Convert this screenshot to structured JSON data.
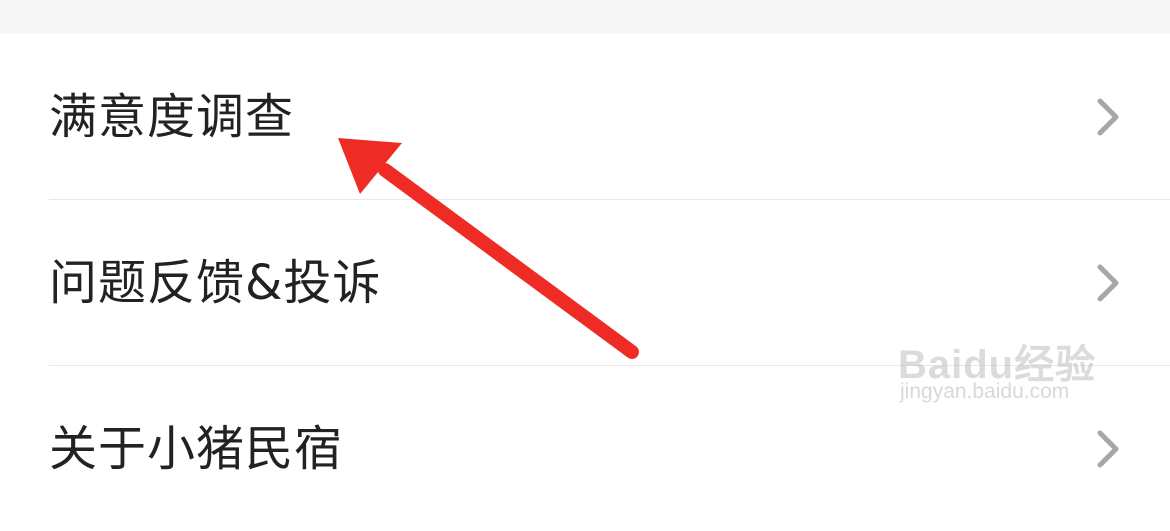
{
  "menu": {
    "items": [
      {
        "label": "满意度调查",
        "icon": "chevron-right-icon"
      },
      {
        "label": "问题反馈&投诉",
        "icon": "chevron-right-icon"
      },
      {
        "label": "关于小猪民宿",
        "icon": "chevron-right-icon"
      }
    ]
  },
  "annotation": {
    "arrow_color": "#ee2b24"
  },
  "watermark": {
    "logo": "Baidu经验",
    "url": "jingyan.baidu.com"
  },
  "colors": {
    "text": "#222222",
    "chevron": "#a7a7a7",
    "divider": "#e8e8e8",
    "top_gap": "#f6f6f6"
  }
}
